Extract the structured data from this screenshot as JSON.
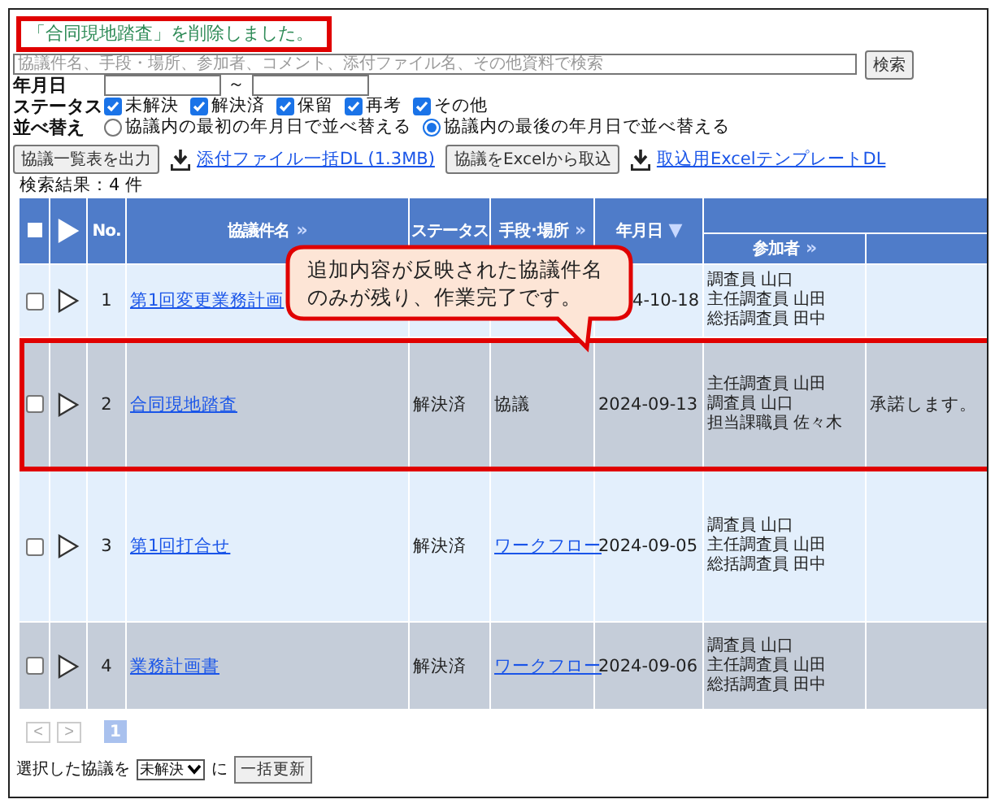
{
  "message": "「合同現地踏査」を削除しました。",
  "search": {
    "placeholder": "協議件名、手段・場所、参加者、コメント、添付ファイル名、その他資料で検索",
    "button": "検索"
  },
  "date_filter": {
    "label": "年月日",
    "separator": "～"
  },
  "status_filter": {
    "label": "ステータス",
    "options": [
      {
        "label": "未解決",
        "checked": true
      },
      {
        "label": "解決済",
        "checked": true
      },
      {
        "label": "保留",
        "checked": true
      },
      {
        "label": "再考",
        "checked": true
      },
      {
        "label": "その他",
        "checked": true
      }
    ]
  },
  "sort": {
    "label": "並べ替え",
    "options": [
      {
        "label": "協議内の最初の年月日で並べ替える",
        "selected": false
      },
      {
        "label": "協議内の最後の年月日で並べ替える",
        "selected": true
      }
    ]
  },
  "actions": [
    {
      "kind": "button",
      "label": "協議一覧表を出力"
    },
    {
      "kind": "download",
      "label": "添付ファイル一括DL (1.3MB)"
    },
    {
      "kind": "button",
      "label": "協議をExcelから取込"
    },
    {
      "kind": "download",
      "label": "取込用ExcelテンプレートDL"
    }
  ],
  "result_count": "検索結果：4 件",
  "table": {
    "select_all": {
      "checked": false
    },
    "columns": [
      {
        "kind": "checkbox"
      },
      {
        "kind": "expand"
      },
      {
        "kind": "text",
        "label": "No."
      },
      {
        "kind": "text",
        "label": "協議件名",
        "mark": "»"
      },
      {
        "kind": "text",
        "label": "ステータス"
      },
      {
        "kind": "text",
        "label": "手段･場所",
        "mark": "»"
      },
      {
        "kind": "text",
        "label": "年月日",
        "mark": "▼"
      },
      {
        "kind": "group",
        "children": [
          {
            "kind": "text",
            "label": "参加者",
            "mark": "»"
          },
          {
            "kind": "blank"
          }
        ]
      }
    ],
    "rows": [
      {
        "checked": false,
        "no": "1",
        "title": "第1回変更業務計画",
        "date": "4-10-18",
        "participants": [
          "調査員 山口",
          "主任調査員 山田",
          "総括調査員 田中"
        ],
        "highlighted": false
      },
      {
        "checked": false,
        "no": "2",
        "title": "合同現地踏査",
        "status": "解決済",
        "method": "協議",
        "method_link": false,
        "date": "2024-09-13",
        "participants": [
          "主任調査員 山田",
          "調査員 山口",
          "担当課職員 佐々木"
        ],
        "comment": "承諾します。",
        "highlighted": true
      },
      {
        "checked": false,
        "no": "3",
        "title": "第1回打合せ",
        "status": "解決済",
        "method": "ワークフロー",
        "method_link": true,
        "date": "2024-09-05",
        "participants": [
          "調査員 山口",
          "主任調査員 山田",
          "総括調査員 田中"
        ],
        "highlighted": false
      },
      {
        "checked": false,
        "no": "4",
        "title": "業務計画書",
        "status": "解決済",
        "method": "ワークフロー",
        "method_link": true,
        "date": "2024-09-06",
        "participants": [
          "調査員 山口",
          "主任調査員 山田",
          "総括調査員 田中"
        ],
        "highlighted": false
      }
    ]
  },
  "pagination": {
    "prev": "<",
    "next": ">",
    "pages": [
      {
        "label": "1",
        "selected": true
      }
    ]
  },
  "bulk": {
    "prefix": "選択した協議を",
    "select": "未解決",
    "suffix": "に",
    "button": "一括更新"
  },
  "callout": {
    "lines": [
      "追加内容が反映された協議件名",
      "のみが残り、作業完了です。"
    ]
  }
}
